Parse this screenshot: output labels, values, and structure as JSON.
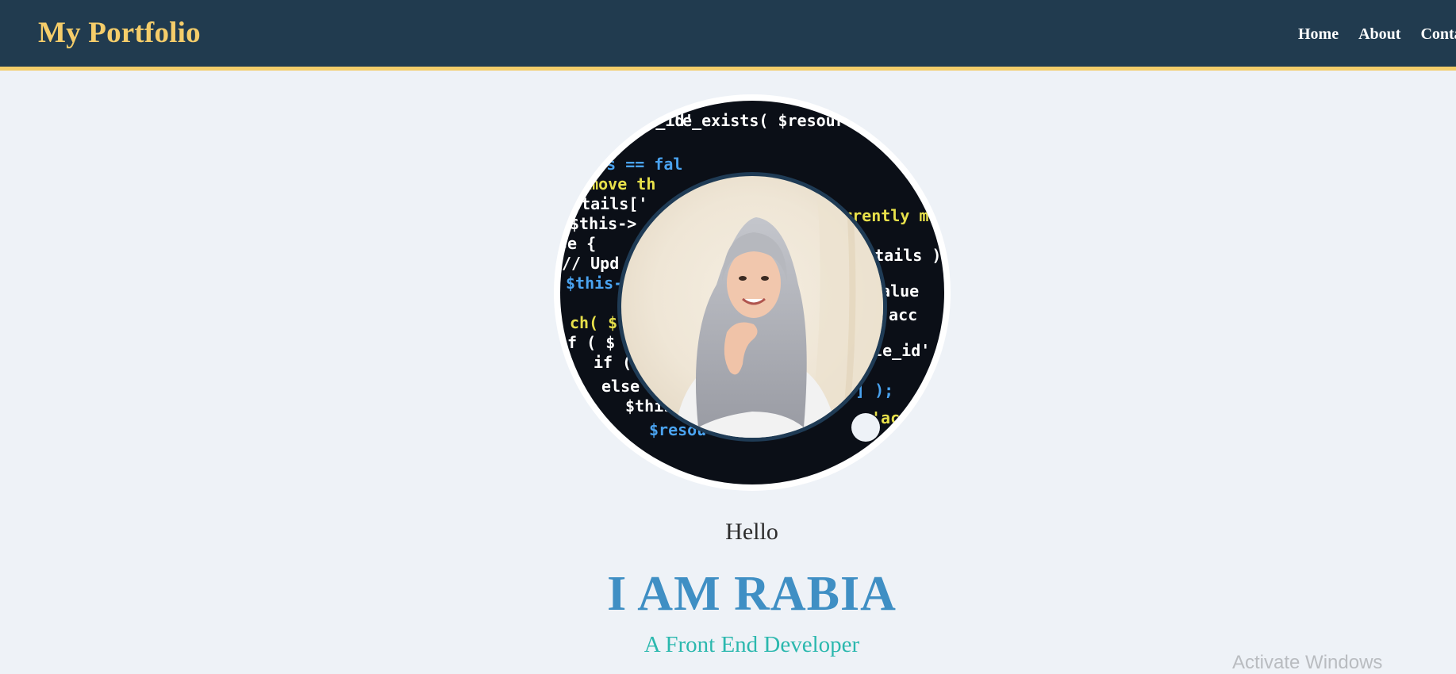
{
  "navbar": {
    "brand": "My Portfolio",
    "links": [
      "Home",
      "About",
      "Contact"
    ]
  },
  "hero": {
    "greeting": "Hello",
    "name": "I AM RABIA",
    "role": "A Front End Developer",
    "code_snippets": [
      "$resource_id'",
      "le_exists( $resource_details['id']",
      "cess == fal",
      "Remove th",
      "details['",
      "$this->",
      "se {",
      "// Upd",
      "$this-",
      "ch( $",
      "if ( $",
      "if (",
      "else i",
      "$this->",
      "$resou",
      "currently ma",
      "details )",
      "value",
      "'acc",
      "ble_id'",
      "] );",
      "'access"
    ]
  },
  "system": {
    "watermark": "Activate Windows"
  },
  "colors": {
    "navbar_bg": "#213b4f",
    "accent_gold": "#f3cd6a",
    "page_bg": "#eef2f7",
    "name_blue": "#3f8fc4",
    "role_teal": "#2bb8ae"
  }
}
